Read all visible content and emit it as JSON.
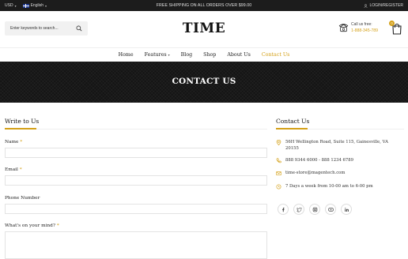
{
  "topbar": {
    "currency": "USD",
    "language": "English",
    "promo": "FREE SHIPPING ON ALL ORDERS OVER $99.00",
    "account": "LOGIN/REGISTER"
  },
  "header": {
    "search_placeholder": "Enter keywords to search...",
    "logo": "TIME",
    "call_label": "Call us free:",
    "call_number": "1-888-345-789",
    "cart_count": "0"
  },
  "nav": {
    "items": [
      "Home",
      "Features",
      "Blog",
      "Shop",
      "About Us",
      "Contact Us"
    ]
  },
  "banner": {
    "title": "CONTACT US"
  },
  "write": {
    "title": "Write to Us",
    "fields": [
      {
        "label": "Name",
        "required": "*"
      },
      {
        "label": "Email",
        "required": "*"
      },
      {
        "label": "Phone Number",
        "required": ""
      },
      {
        "label": "What's on your mind?",
        "required": "*"
      }
    ]
  },
  "contact": {
    "title": "Contact Us",
    "address": "56H Wellington Road, Suite 115, Gainesville, VA 20155",
    "phone": "888 9344 6000 - 888 1234 6789",
    "email": "time-store@magentech.com",
    "hours": "7 Days a week from 10-00 am to 6-00 pm",
    "social": [
      "facebook-icon",
      "twitter-icon",
      "instagram-icon",
      "youtube-icon",
      "linkedin-icon"
    ]
  },
  "colors": {
    "accent": "#d4a017",
    "dark": "#1c1c1c"
  }
}
